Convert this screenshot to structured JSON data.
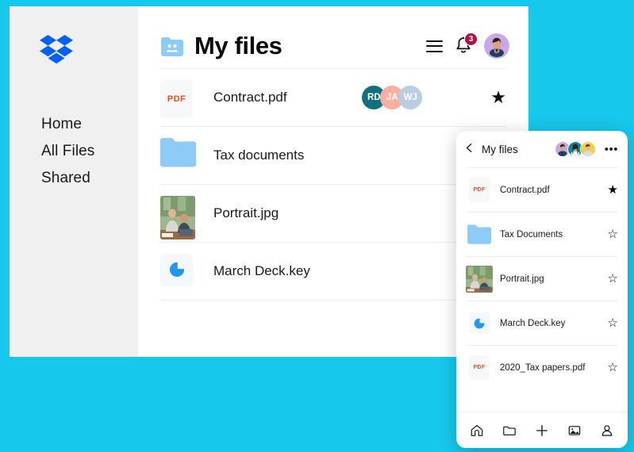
{
  "background_color": "#16c8ec",
  "desktop": {
    "sidebar": {
      "logo_name": "dropbox-logo",
      "items": [
        {
          "label": "Home",
          "name": "sidebar-item-home"
        },
        {
          "label": "All Files",
          "name": "sidebar-item-all-files"
        },
        {
          "label": "Shared",
          "name": "sidebar-item-shared"
        }
      ]
    },
    "header": {
      "folder_icon": "shared-folder-icon",
      "title": "My files",
      "menu_icon": "hamburger-menu-icon",
      "bell_icon": "notification-bell-icon",
      "bell_badge": "3",
      "bell_badge_color": "#b3123f",
      "avatar_name": "user-avatar",
      "avatar_bg": "#c9a7e8"
    },
    "files": [
      {
        "name": "Contract.pdf",
        "icon": "pdf-file-icon",
        "icon_label": "PDF",
        "shared_avatars": [
          {
            "initials": "RD",
            "color": "#11707f"
          },
          {
            "initials": "JA",
            "color": "#ffaea0"
          },
          {
            "initials": "WJ",
            "color": "#b9cde3"
          }
        ],
        "starred": true,
        "star_glyph": "★"
      },
      {
        "name": "Tax documents",
        "icon": "folder-icon",
        "icon_color": "#8ecbf7",
        "shared_avatars": [],
        "starred": false
      },
      {
        "name": "Portrait.jpg",
        "icon": "photo-thumbnail-icon",
        "shared_avatars": [],
        "starred": false
      },
      {
        "name": "March Deck.key",
        "icon": "keynote-chart-icon",
        "icon_color": "#2196f3",
        "shared_avatars": [],
        "starred": false
      }
    ]
  },
  "mobile_panel": {
    "back_icon": "chevron-left-icon",
    "title": "My files",
    "avatars": [
      {
        "name": "panel-avatar-1",
        "bg": "#c9a7e8"
      },
      {
        "name": "panel-avatar-2",
        "bg": "#0d8799"
      },
      {
        "name": "panel-avatar-3",
        "bg": "#f7cf43"
      }
    ],
    "more_icon": "more-horizontal-icon",
    "more_glyph": "•••",
    "files": [
      {
        "name": "Contract.pdf",
        "icon": "pdf-file-icon",
        "icon_label": "PDF",
        "starred": true,
        "star_glyph": "★"
      },
      {
        "name": "Tax Documents",
        "icon": "folder-icon",
        "starred": false,
        "star_glyph": "☆"
      },
      {
        "name": "Portrait.jpg",
        "icon": "photo-thumbnail-icon",
        "starred": false,
        "star_glyph": "☆"
      },
      {
        "name": "March Deck.key",
        "icon": "keynote-chart-icon",
        "starred": false,
        "star_glyph": "☆"
      },
      {
        "name": "2020_Tax papers.pdf",
        "icon": "pdf-file-icon",
        "icon_label": "PDF",
        "starred": false,
        "star_glyph": "☆"
      }
    ],
    "tabs": [
      {
        "name": "tab-home",
        "icon": "home-icon"
      },
      {
        "name": "tab-files",
        "icon": "folder-icon"
      },
      {
        "name": "tab-create",
        "icon": "plus-icon"
      },
      {
        "name": "tab-photos",
        "icon": "photo-icon"
      },
      {
        "name": "tab-account",
        "icon": "person-icon"
      }
    ]
  }
}
